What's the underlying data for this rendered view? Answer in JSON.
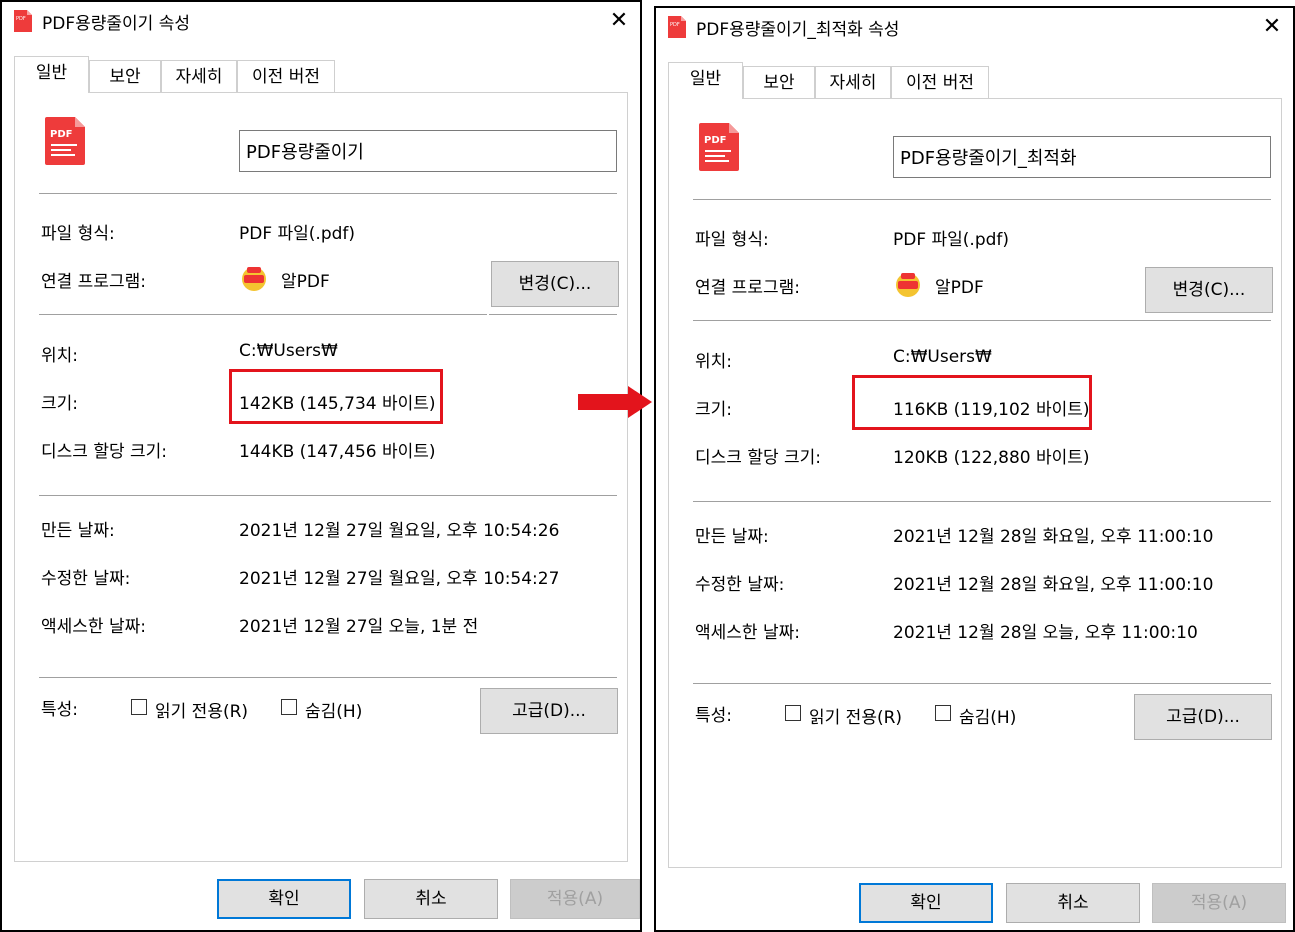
{
  "colors": {
    "accent": "#0078d7",
    "highlight": "#e3141c",
    "pdf_red": "#ee3b3b"
  },
  "icons": {
    "file_icon": "pdf-file-icon",
    "app_icon": "alpdf-app-icon",
    "close": "close-icon",
    "arrow": "right-arrow-icon"
  },
  "left": {
    "title": "PDF용량줄이기 속성",
    "close": "✕",
    "tabs": [
      "일반",
      "보안",
      "자세히",
      "이전 버전"
    ],
    "filename": "PDF용량줄이기",
    "labels": {
      "type": "파일 형식:",
      "program": "연결 프로그램:",
      "location": "위치:",
      "size": "크기:",
      "disk": "디스크 할당 크기:",
      "created": "만든 날짜:",
      "modified": "수정한 날짜:",
      "accessed": "액세스한 날짜:",
      "attrs": "특성:"
    },
    "values": {
      "type": "PDF 파일(.pdf)",
      "program": "알PDF",
      "location": "C:₩Users₩",
      "size": "142KB (145,734 바이트)",
      "disk": "144KB (147,456 바이트)",
      "created": "2021년 12월 27일 월요일, 오후 10:54:26",
      "modified": "2021년 12월 27일 월요일, 오후 10:54:27",
      "accessed": "2021년 12월 27일 오늘, 1분 전"
    },
    "buttons": {
      "change": "변경(C)...",
      "advanced": "고급(D)...",
      "ok": "확인",
      "cancel": "취소",
      "apply": "적용(A)"
    },
    "checkboxes": {
      "readonly": "읽기 전용(R)",
      "hidden": "숨김(H)"
    }
  },
  "right": {
    "title": "PDF용량줄이기_최적화 속성",
    "close": "✕",
    "tabs": [
      "일반",
      "보안",
      "자세히",
      "이전 버전"
    ],
    "filename": "PDF용량줄이기_최적화",
    "labels": {
      "type": "파일 형식:",
      "program": "연결 프로그램:",
      "location": "위치:",
      "size": "크기:",
      "disk": "디스크 할당 크기:",
      "created": "만든 날짜:",
      "modified": "수정한 날짜:",
      "accessed": "액세스한 날짜:",
      "attrs": "특성:"
    },
    "values": {
      "type": "PDF 파일(.pdf)",
      "program": "알PDF",
      "location": "C:₩Users₩",
      "size": "116KB (119,102 바이트)",
      "disk": "120KB (122,880 바이트)",
      "created": "2021년 12월 28일 화요일, 오후 11:00:10",
      "modified": "2021년 12월 28일 화요일, 오후 11:00:10",
      "accessed": "2021년 12월 28일 오늘, 오후 11:00:10"
    },
    "buttons": {
      "change": "변경(C)...",
      "advanced": "고급(D)...",
      "ok": "확인",
      "cancel": "취소",
      "apply": "적용(A)"
    },
    "checkboxes": {
      "readonly": "읽기 전용(R)",
      "hidden": "숨김(H)"
    }
  }
}
